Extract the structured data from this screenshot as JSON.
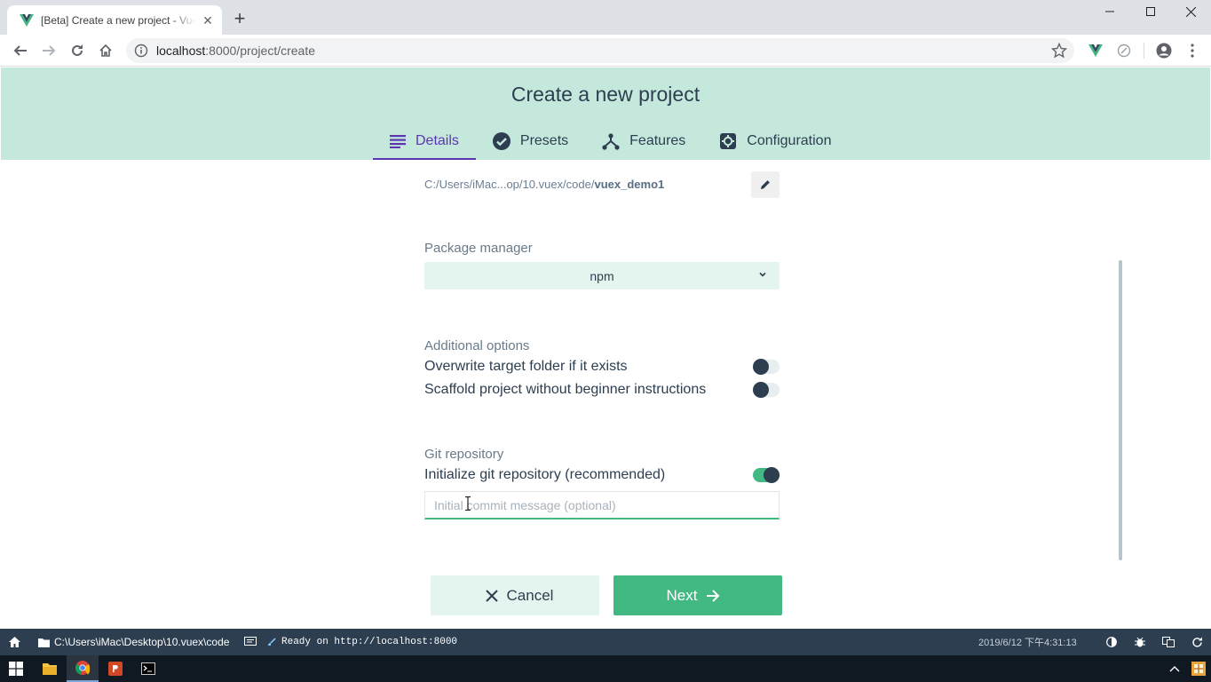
{
  "browser": {
    "tab_title": "[Beta] Create a new project - Vue CLI",
    "tab_close": "✕",
    "new_tab": "+",
    "url_host": "localhost",
    "url_path": ":8000/project/create"
  },
  "header": {
    "title": "Create a new project",
    "tabs": [
      {
        "label": "Details",
        "icon": "list-icon",
        "active": true
      },
      {
        "label": "Presets",
        "icon": "check-circle-icon",
        "active": false
      },
      {
        "label": "Features",
        "icon": "fork-icon",
        "active": false
      },
      {
        "label": "Configuration",
        "icon": "gear-icon",
        "active": false
      }
    ]
  },
  "details": {
    "folder_prefix": "C:/Users/iMac...op/10.vuex/code/",
    "folder_name": "vuex_demo1",
    "package_manager_label": "Package manager",
    "package_manager_value": "npm",
    "additional_options_label": "Additional options",
    "options": [
      {
        "label": "Overwrite target folder if it exists",
        "on": false
      },
      {
        "label": "Scaffold project without beginner instructions",
        "on": false
      }
    ],
    "git_label": "Git repository",
    "git_init_label": "Initialize git repository (recommended)",
    "git_init_on": true,
    "commit_placeholder": "Initial commit message (optional)",
    "commit_value": ""
  },
  "actions": {
    "cancel_label": "Cancel",
    "next_label": "Next"
  },
  "statusbar": {
    "cwd": "C:\\Users\\iMac\\Desktop\\10.vuex\\code",
    "log": "Ready on http://localhost:8000",
    "datetime": "2019/6/12 下午4:31:13"
  },
  "colors": {
    "accent": "#42b983",
    "header_bg": "#c4e9dc",
    "active_tab": "#5e35b1",
    "statusbar_bg": "#2c3e50"
  }
}
